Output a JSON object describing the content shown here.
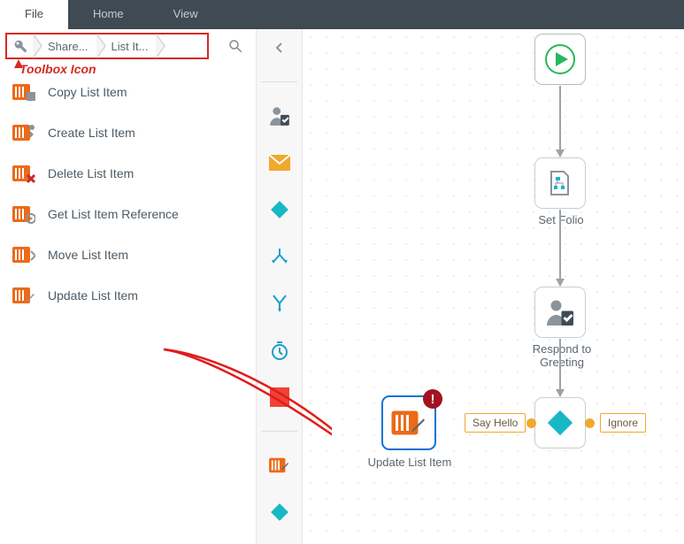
{
  "menu": {
    "file": "File",
    "home": "Home",
    "view": "View"
  },
  "crumbs": {
    "share": "Share...",
    "listit": "List It..."
  },
  "annotation": "Toolbox Icon",
  "toolbox": [
    {
      "label": "Copy List Item"
    },
    {
      "label": "Create List Item"
    },
    {
      "label": "Delete List Item"
    },
    {
      "label": "Get List Item Reference"
    },
    {
      "label": "Move List Item"
    },
    {
      "label": "Update List Item"
    }
  ],
  "canvas": {
    "setFolio": "Set Folio",
    "respond": "Respond to Greeting",
    "update": "Update List Item",
    "sayHello": "Say Hello",
    "ignore": "Ignore"
  },
  "colors": {
    "accent": "#17b8c4",
    "orange": "#ec6a18",
    "red": "#ef4335",
    "green": "#27b859"
  }
}
